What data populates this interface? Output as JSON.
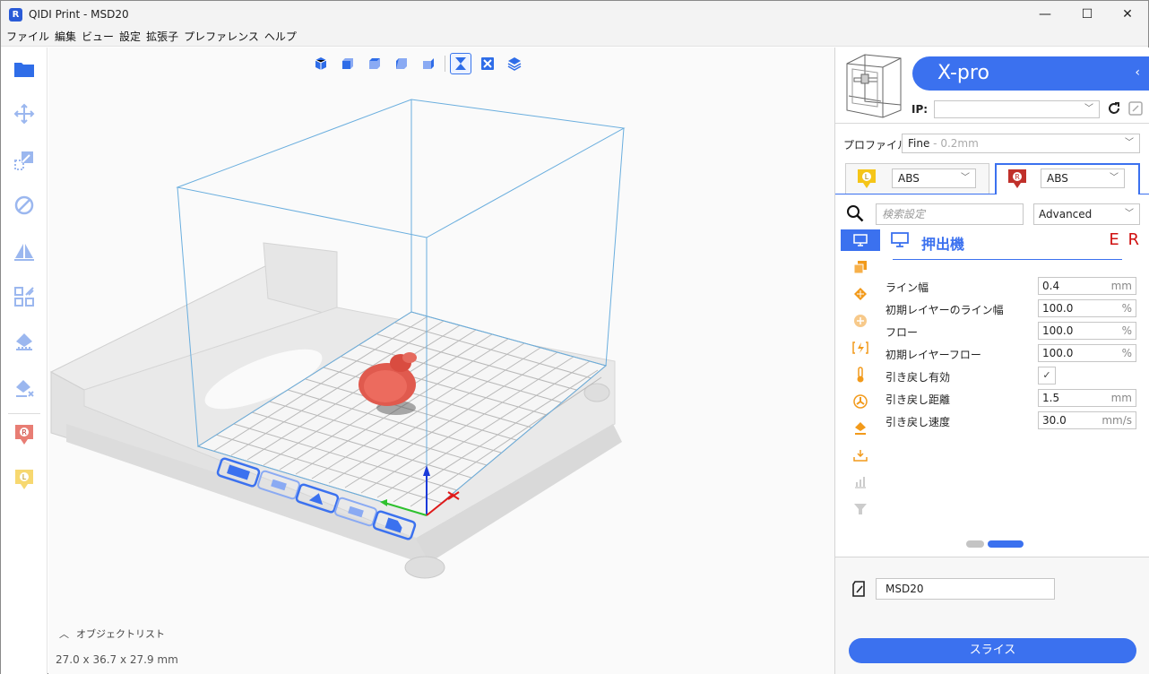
{
  "window": {
    "title": "QIDI Print - MSD20",
    "logo_letter": "R",
    "minimize": "—",
    "maximize": "☐",
    "close": "✕"
  },
  "menu": [
    "ファイル",
    "編集",
    "ビュー",
    "設定",
    "拡張子",
    "プレファレンス",
    "ヘルプ"
  ],
  "left_toolbar": [
    "open-folder-icon",
    "move-icon",
    "scale-icon",
    "rotate-icon",
    "mirror-icon",
    "arrange-icon",
    "support-icon",
    "support-remove-icon",
    "extruder-r-icon",
    "extruder-l-icon"
  ],
  "left_toolbar_badges": {
    "r": "R",
    "l": "L"
  },
  "view_toolbar": [
    "view-3d-icon",
    "view-front-icon",
    "view-top-icon",
    "view-left-icon",
    "view-right-icon",
    "view-solid-icon",
    "view-xray-icon",
    "view-layers-icon"
  ],
  "viewport": {
    "object_list_label": "オブジェクトリスト",
    "dimensions": "27.0 x 36.7 x 27.9 mm"
  },
  "printer": {
    "name": "X-pro",
    "ip_label": "IP:",
    "ip_value": ""
  },
  "profile": {
    "label": "プロファイル",
    "value": "Fine",
    "value_sub": " - 0.2mm"
  },
  "extruders": {
    "left": {
      "badge": "L",
      "material": "ABS"
    },
    "right": {
      "badge": "R",
      "material": "ABS"
    }
  },
  "search": {
    "placeholder": "検索設定",
    "mode": "Advanced"
  },
  "section": {
    "title": "押出機",
    "er": "E R"
  },
  "categories": [
    "extruder-icon",
    "shell-icon",
    "infill-icon",
    "material-icon",
    "speed-icon",
    "temperature-icon",
    "cooling-icon",
    "support-icon",
    "adhesion-icon",
    "dual-icon",
    "special-icon"
  ],
  "settings": [
    {
      "label": "ライン幅",
      "value": "0.4",
      "unit": "mm"
    },
    {
      "label": "初期レイヤーのライン幅",
      "value": "100.0",
      "unit": "%"
    },
    {
      "label": "フロー",
      "value": "100.0",
      "unit": "%"
    },
    {
      "label": "初期レイヤーフロー",
      "value": "100.0",
      "unit": "%"
    },
    {
      "label": "引き戻し有効",
      "value": "✓",
      "unit": ""
    },
    {
      "label": "引き戻し距離",
      "value": "1.5",
      "unit": "mm"
    },
    {
      "label": "引き戻し速度",
      "value": "30.0",
      "unit": "mm/s"
    }
  ],
  "pagination": {
    "count": 2,
    "active": 2
  },
  "output": {
    "file_name": "MSD20",
    "slice_label": "スライス"
  },
  "colors": {
    "accent": "#3b71ef",
    "er_red": "#d01010",
    "extruder_l": "#f5c518",
    "extruder_r": "#c0302a",
    "model": "#e05a4e",
    "icon_orange": "#f29a1b"
  }
}
